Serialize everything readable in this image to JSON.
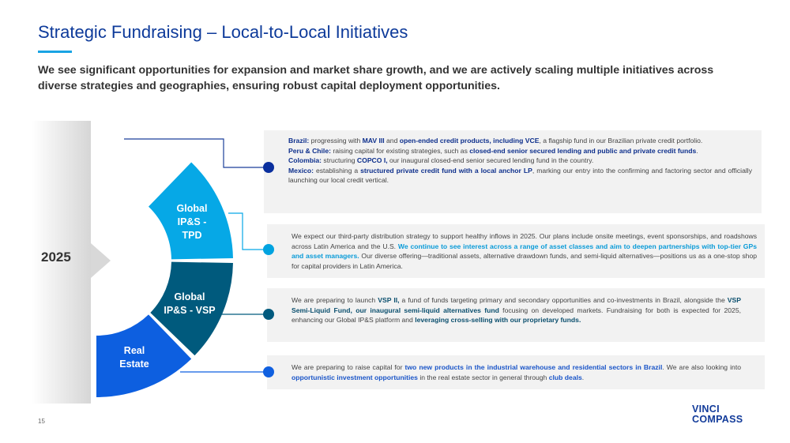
{
  "header": {
    "title": "Strategic Fundraising – Local-to-Local Initiatives",
    "subtitle": "We see significant opportunities for expansion and market share growth, and we are actively scaling multiple initiatives across diverse strategies and geographies, ensuring robust capital deployment opportunities."
  },
  "timeline": {
    "year": "2025"
  },
  "segments": [
    {
      "name": "Global IP&S - TPD",
      "lines": [
        "Global",
        "IP&S -",
        "TPD"
      ],
      "color": "#06a8e6"
    },
    {
      "name": "Global IP&S - VSP",
      "lines": [
        "Global",
        "IP&S - VSP"
      ],
      "color": "#005a7d"
    },
    {
      "name": "Real Estate",
      "lines": [
        "Real",
        "Estate"
      ],
      "color": "#0d5fe0"
    }
  ],
  "colors": {
    "accent": "#0d3a9a",
    "dot1": "#0a2f9e",
    "dot2": "#00a3e0",
    "dot3": "#005a7e",
    "dot4": "#1060e0"
  },
  "boxes": [
    {
      "paragraphs": [
        [
          {
            "t": "Brazil:",
            "c": "#0d2f8c",
            "b": true
          },
          {
            "t": " progressing with "
          },
          {
            "t": "MAV III",
            "c": "#0d2f8c",
            "b": true
          },
          {
            "t": " and "
          },
          {
            "t": "open-ended credit products, including VCE",
            "c": "#0d2f8c",
            "b": true
          },
          {
            "t": ", a flagship fund in our Brazilian private credit portfolio."
          }
        ],
        [
          {
            "t": "Peru & Chile:",
            "c": "#0d2f8c",
            "b": true
          },
          {
            "t": " raising capital for existing strategies, such as "
          },
          {
            "t": "closed-end senior secured lending and public and private credit funds",
            "c": "#0d2f8c",
            "b": true
          },
          {
            "t": "."
          }
        ],
        [
          {
            "t": "Colombia:",
            "c": "#0d2f8c",
            "b": true
          },
          {
            "t": " structuring "
          },
          {
            "t": "COPCO I,",
            "c": "#0d2f8c",
            "b": true
          },
          {
            "t": " our inaugural closed-end senior secured lending fund in the country."
          }
        ],
        [
          {
            "t": "Mexico:",
            "c": "#0d2f8c",
            "b": true
          },
          {
            "t": " establishing a "
          },
          {
            "t": "structured private credit fund with a local anchor LP",
            "c": "#0d2f8c",
            "b": true
          },
          {
            "t": ", marking our entry into the confirming and factoring sector and officially launching our local credit vertical."
          }
        ]
      ]
    },
    {
      "paragraphs": [
        [
          {
            "t": "We expect our third-party distribution strategy to support healthy inflows in 2025. Our plans include onsite meetings, event sponsorships, and roadshows across Latin America and the U.S. "
          },
          {
            "t": "We continue to see interest across a range of asset classes and aim to deepen partnerships with top-tier GPs and asset managers.",
            "c": "#0a9bd8",
            "b": true
          },
          {
            "t": " Our diverse offering—traditional assets, alternative drawdown funds, and semi-liquid alternatives—positions us as a one-stop shop for capital providers in Latin America."
          }
        ]
      ]
    },
    {
      "paragraphs": [
        [
          {
            "t": "We are preparing to launch "
          },
          {
            "t": "VSP II,",
            "c": "#0b4f6e",
            "b": true
          },
          {
            "t": " a fund of funds targeting primary and secondary opportunities and co-investments in Brazil, alongside the "
          },
          {
            "t": "VSP Semi-Liquid Fund, our inaugural semi-liquid alternatives fund",
            "c": "#0b4f6e",
            "b": true
          },
          {
            "t": " focusing on developed markets. Fundraising for both is expected for 2025, enhancing our Global IP&S platform and "
          },
          {
            "t": "leveraging cross-selling with our proprietary funds.",
            "c": "#0b4f6e",
            "b": true
          }
        ]
      ]
    },
    {
      "paragraphs": [
        [
          {
            "t": "We are preparing to raise capital for "
          },
          {
            "t": "two new products in the industrial warehouse and residential sectors in Brazil",
            "c": "#1a55c8",
            "b": true
          },
          {
            "t": ". We are also looking into "
          },
          {
            "t": "opportunistic investment opportunities",
            "c": "#1a55c8",
            "b": true
          },
          {
            "t": " in the real estate sector in general through "
          },
          {
            "t": "club deals",
            "c": "#1a55c8",
            "b": true
          },
          {
            "t": "."
          }
        ]
      ]
    }
  ],
  "footer": {
    "page_number": "15",
    "logo_line1": "VINCI",
    "logo_line2": "COMPASS"
  }
}
